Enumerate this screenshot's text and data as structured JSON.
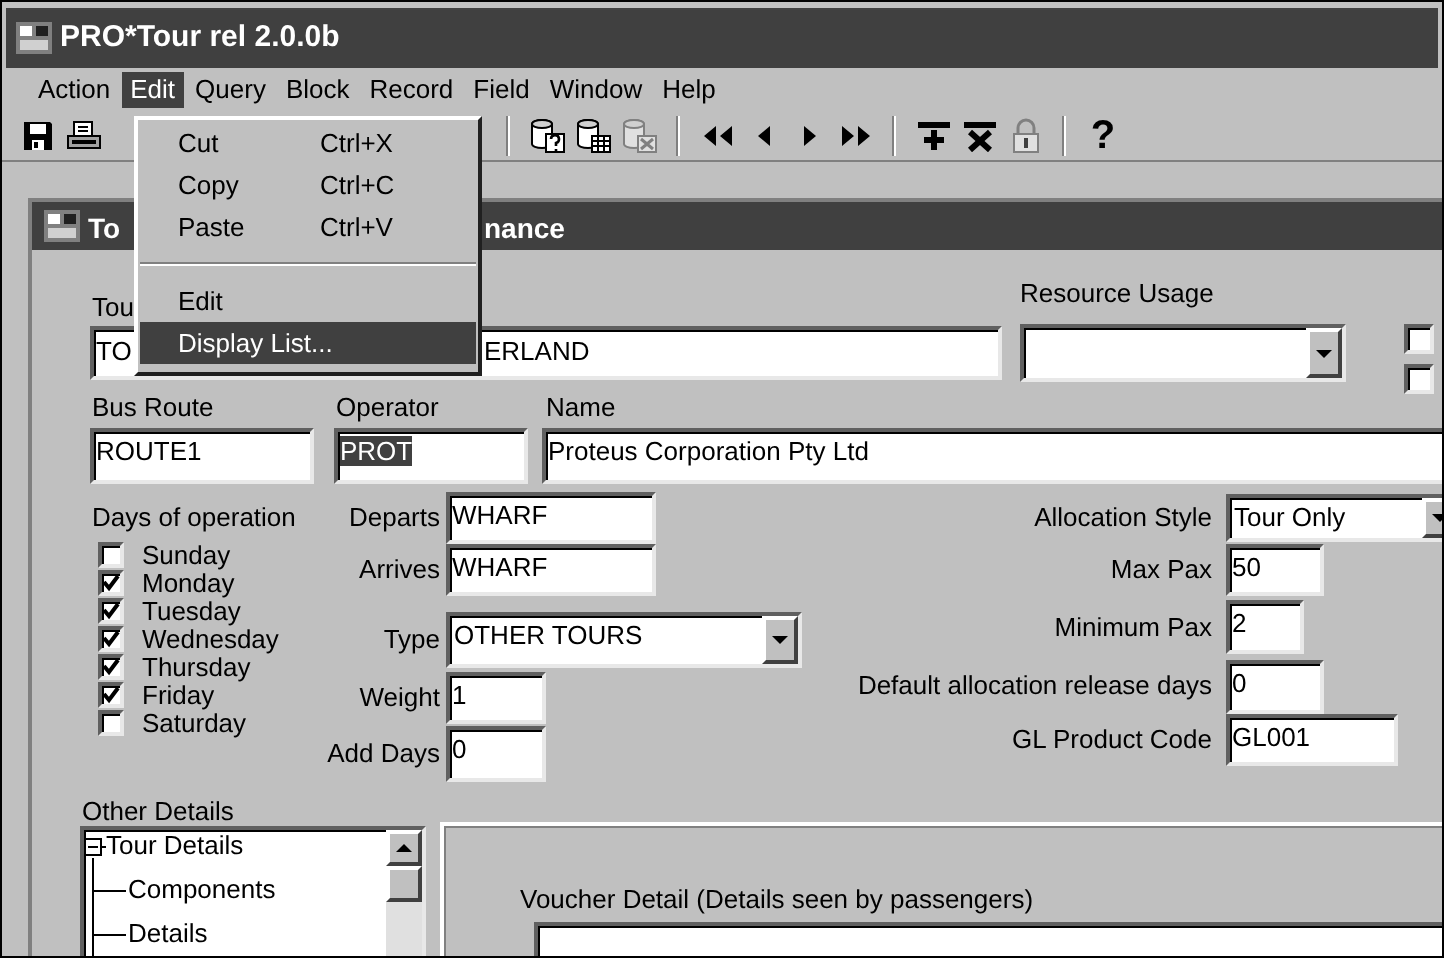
{
  "window": {
    "title": "PRO*Tour rel 2.0.0b"
  },
  "menu_bar": [
    {
      "label": "Action",
      "selected": false
    },
    {
      "label": "Edit",
      "selected": true
    },
    {
      "label": "Query",
      "selected": false
    },
    {
      "label": "Block",
      "selected": false
    },
    {
      "label": "Record",
      "selected": false
    },
    {
      "label": "Field",
      "selected": false
    },
    {
      "label": "Window",
      "selected": false
    },
    {
      "label": "Help",
      "selected": false
    }
  ],
  "toolbar": [
    {
      "kind": "save",
      "disabled": false
    },
    {
      "kind": "print",
      "disabled": false
    },
    {
      "kind": "separator"
    },
    {
      "kind": "db-query",
      "disabled": false
    },
    {
      "kind": "db-grid",
      "disabled": false
    },
    {
      "kind": "db-delete",
      "disabled": true
    },
    {
      "kind": "separator"
    },
    {
      "kind": "first",
      "disabled": false
    },
    {
      "kind": "previous",
      "disabled": false
    },
    {
      "kind": "next",
      "disabled": false
    },
    {
      "kind": "last",
      "disabled": false
    },
    {
      "kind": "separator"
    },
    {
      "kind": "insert",
      "disabled": false
    },
    {
      "kind": "remove",
      "disabled": false
    },
    {
      "kind": "lock",
      "disabled": true
    },
    {
      "kind": "separator"
    },
    {
      "kind": "help",
      "label": "?",
      "disabled": false
    }
  ],
  "edit_menu": {
    "items": [
      {
        "kind": "item",
        "label": "Cut",
        "shortcut": "Ctrl+X",
        "selected": false
      },
      {
        "kind": "item",
        "label": "Copy",
        "shortcut": "Ctrl+C",
        "selected": false
      },
      {
        "kind": "item",
        "label": "Paste",
        "shortcut": "Ctrl+V",
        "selected": false
      },
      {
        "kind": "separator"
      },
      {
        "kind": "item",
        "label": "Edit",
        "selected": false
      },
      {
        "kind": "item",
        "label": "Display List...",
        "selected": true
      }
    ]
  },
  "form_window": {
    "title_parts": [
      "To",
      "nance"
    ]
  },
  "form": {
    "tour": {
      "label": "Tou",
      "value_parts": [
        "TO",
        "ERLAND"
      ]
    },
    "resource_usage": {
      "label": "Resource Usage"
    },
    "flags": [
      {
        "checked": false
      },
      {
        "checked": false
      }
    ],
    "bus_route": {
      "label": "Bus Route",
      "value": "ROUTE1"
    },
    "operator": {
      "label": "Operator",
      "value": "PROT",
      "highlighted": true
    },
    "name": {
      "label": "Name",
      "value": "Proteus Corporation Pty Ltd"
    },
    "days_of_operation": {
      "label": "Days of operation",
      "days": [
        {
          "label": "Sunday",
          "checked": false
        },
        {
          "label": "Monday",
          "checked": true
        },
        {
          "label": "Tuesday",
          "checked": true
        },
        {
          "label": "Wednesday",
          "checked": true
        },
        {
          "label": "Thursday",
          "checked": true
        },
        {
          "label": "Friday",
          "checked": true
        },
        {
          "label": "Saturday",
          "checked": false
        }
      ]
    },
    "departs": {
      "label": "Departs",
      "value": "WHARF"
    },
    "arrives": {
      "label": "Arrives",
      "value": "WHARF"
    },
    "type": {
      "label": "Type",
      "value": "OTHER TOURS"
    },
    "weight": {
      "label": "Weight",
      "value": "1"
    },
    "add_days": {
      "label": "Add Days",
      "value": "0"
    },
    "allocation_style": {
      "label": "Allocation Style",
      "value": "Tour Only"
    },
    "max_pax": {
      "label": "Max Pax",
      "value": "50"
    },
    "minimum_pax": {
      "label": "Minimum Pax",
      "value": "2"
    },
    "default_release_days": {
      "label": "Default allocation release days",
      "value": "0"
    },
    "gl_product_code": {
      "label": "GL Product Code",
      "value": "GL001"
    }
  },
  "other_details": {
    "label": "Other Details",
    "tree": [
      {
        "label": "Tour Details",
        "expanded": true,
        "children": [
          {
            "label": "Components"
          },
          {
            "label": "Details"
          }
        ]
      }
    ]
  },
  "voucher_detail": {
    "label": "Voucher Detail (Details seen by passengers)"
  }
}
